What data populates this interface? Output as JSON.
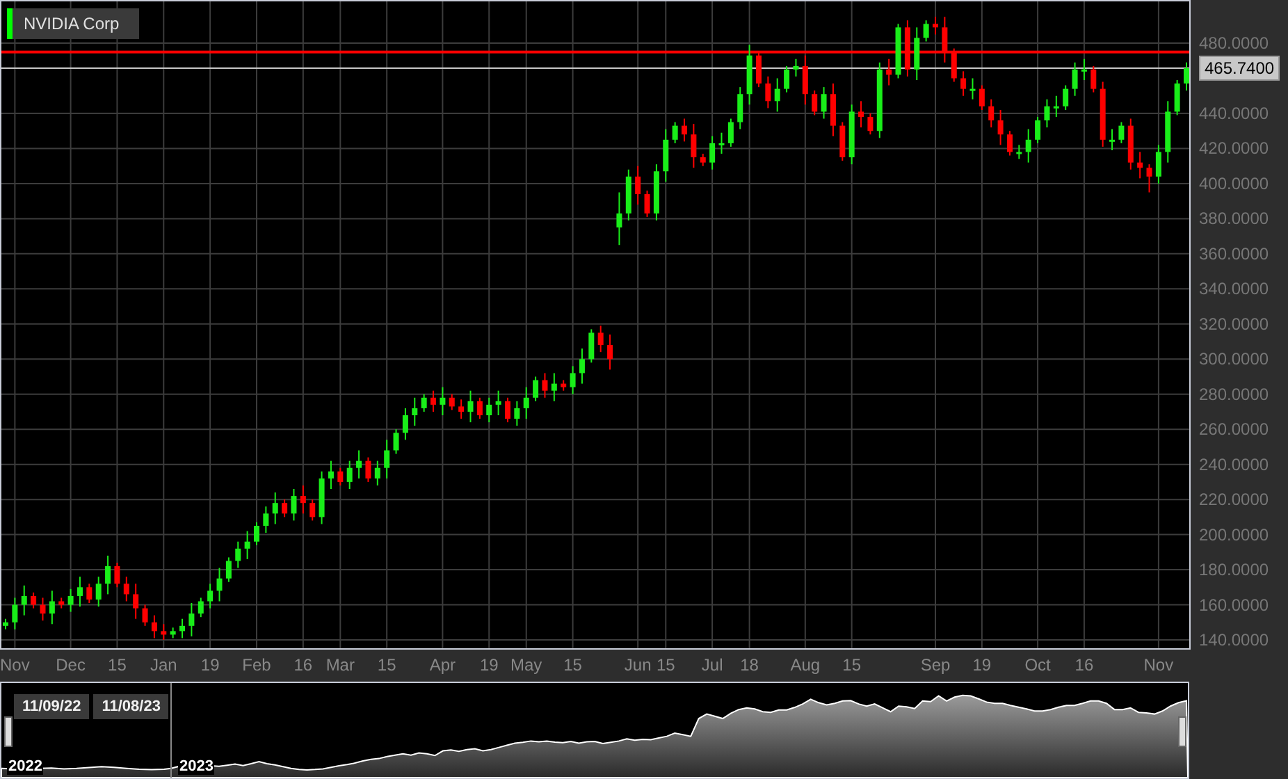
{
  "legend": {
    "label": "NVIDIA Corp",
    "color": "#00ff00"
  },
  "chart_data": {
    "type": "candlestick",
    "categories": [
      null,
      "Nov",
      null,
      null,
      null,
      null,
      null,
      "Dec",
      null,
      null,
      null,
      null,
      "15",
      null,
      null,
      null,
      null,
      "Jan",
      null,
      null,
      null,
      null,
      "19",
      null,
      null,
      null,
      null,
      "Feb",
      null,
      null,
      null,
      null,
      "16",
      null,
      null,
      null,
      "Mar",
      null,
      null,
      null,
      null,
      "15",
      null,
      null,
      null,
      null,
      null,
      "Apr",
      null,
      null,
      null,
      null,
      "19",
      null,
      null,
      null,
      "May",
      null,
      null,
      null,
      null,
      "15",
      null,
      null,
      null,
      null,
      null,
      null,
      "Jun",
      null,
      null,
      "15",
      null,
      null,
      null,
      null,
      "Jul",
      null,
      null,
      null,
      "18",
      null,
      null,
      null,
      null,
      null,
      "Aug",
      null,
      null,
      null,
      null,
      "15",
      null,
      null,
      null,
      null,
      null,
      null,
      null,
      null,
      "Sep",
      null,
      null,
      null,
      null,
      "19",
      null,
      null,
      null,
      null,
      null,
      "Oct",
      null,
      null,
      null,
      null,
      "16",
      null,
      null,
      null,
      null,
      null,
      null,
      null,
      "Nov",
      null,
      null,
      null
    ],
    "ohlc": [
      [
        148,
        152,
        146,
        150
      ],
      [
        150,
        164,
        146,
        160
      ],
      [
        160,
        171,
        154,
        165
      ],
      [
        165,
        167,
        158,
        160
      ],
      [
        160,
        164,
        151,
        155
      ],
      [
        155,
        168,
        149,
        162
      ],
      [
        162,
        164,
        158,
        160
      ],
      [
        160,
        169,
        156,
        165
      ],
      [
        165,
        176,
        159,
        170
      ],
      [
        170,
        172,
        161,
        163
      ],
      [
        163,
        176,
        159,
        172
      ],
      [
        172,
        188,
        166,
        182
      ],
      [
        182,
        184,
        170,
        172
      ],
      [
        172,
        176,
        162,
        166
      ],
      [
        166,
        172,
        152,
        158
      ],
      [
        158,
        160,
        148,
        150
      ],
      [
        150,
        154,
        141,
        145
      ],
      [
        145,
        149,
        140,
        143
      ],
      [
        143,
        147,
        141,
        145
      ],
      [
        145,
        152,
        141,
        148
      ],
      [
        148,
        161,
        142,
        155
      ],
      [
        155,
        164,
        153,
        162
      ],
      [
        162,
        172,
        158,
        168
      ],
      [
        168,
        181,
        162,
        175
      ],
      [
        175,
        187,
        173,
        185
      ],
      [
        185,
        196,
        181,
        192
      ],
      [
        192,
        202,
        186,
        196
      ],
      [
        196,
        207,
        194,
        205
      ],
      [
        205,
        216,
        201,
        212
      ],
      [
        212,
        224,
        206,
        218
      ],
      [
        218,
        220,
        210,
        212
      ],
      [
        212,
        226,
        208,
        222
      ],
      [
        222,
        228,
        212,
        218
      ],
      [
        218,
        220,
        208,
        210
      ],
      [
        210,
        236,
        206,
        232
      ],
      [
        232,
        242,
        226,
        236
      ],
      [
        236,
        238,
        228,
        230
      ],
      [
        230,
        242,
        226,
        238
      ],
      [
        238,
        248,
        232,
        242
      ],
      [
        242,
        244,
        230,
        232
      ],
      [
        232,
        242,
        228,
        238
      ],
      [
        238,
        254,
        232,
        248
      ],
      [
        248,
        260,
        246,
        258
      ],
      [
        258,
        272,
        254,
        268
      ],
      [
        268,
        278,
        262,
        272
      ],
      [
        272,
        280,
        270,
        278
      ],
      [
        278,
        282,
        270,
        274
      ],
      [
        274,
        284,
        268,
        278
      ],
      [
        278,
        280,
        271,
        273
      ],
      [
        273,
        277,
        266,
        270
      ],
      [
        270,
        282,
        264,
        276
      ],
      [
        276,
        278,
        266,
        268
      ],
      [
        268,
        278,
        264,
        274
      ],
      [
        274,
        282,
        268,
        276
      ],
      [
        276,
        278,
        264,
        266
      ],
      [
        266,
        276,
        262,
        272
      ],
      [
        272,
        284,
        266,
        278
      ],
      [
        278,
        290,
        276,
        288
      ],
      [
        288,
        292,
        278,
        282
      ],
      [
        282,
        292,
        276,
        286
      ],
      [
        286,
        288,
        282,
        284
      ],
      [
        284,
        296,
        280,
        292
      ],
      [
        292,
        306,
        286,
        300
      ],
      [
        300,
        317,
        298,
        315
      ],
      [
        315,
        319,
        304,
        308
      ],
      [
        308,
        314,
        294,
        300
      ],
      [
        375,
        395,
        365,
        383
      ],
      [
        383,
        408,
        379,
        404
      ],
      [
        404,
        410,
        388,
        394
      ],
      [
        394,
        396,
        381,
        383
      ],
      [
        383,
        411,
        379,
        407
      ],
      [
        407,
        431,
        401,
        425
      ],
      [
        425,
        435,
        423,
        433
      ],
      [
        433,
        437,
        424,
        428
      ],
      [
        428,
        434,
        409,
        415
      ],
      [
        415,
        417,
        410,
        412
      ],
      [
        412,
        427,
        408,
        423
      ],
      [
        423,
        429,
        417,
        423
      ],
      [
        423,
        437,
        421,
        435
      ],
      [
        435,
        455,
        431,
        451
      ],
      [
        451,
        479,
        445,
        473
      ],
      [
        473,
        475,
        455,
        457
      ],
      [
        457,
        461,
        443,
        447
      ],
      [
        447,
        460,
        441,
        454
      ],
      [
        454,
        467,
        452,
        465
      ],
      [
        465,
        471,
        461,
        467
      ],
      [
        467,
        473,
        445,
        451
      ],
      [
        451,
        453,
        439,
        441
      ],
      [
        441,
        455,
        437,
        451
      ],
      [
        451,
        457,
        427,
        433
      ],
      [
        433,
        435,
        413,
        415
      ],
      [
        415,
        445,
        411,
        441
      ],
      [
        441,
        447,
        432,
        438
      ],
      [
        438,
        440,
        428,
        430
      ],
      [
        430,
        469,
        426,
        465
      ],
      [
        465,
        471,
        456,
        462
      ],
      [
        462,
        491,
        460,
        489
      ],
      [
        489,
        493,
        461,
        465
      ],
      [
        465,
        489,
        459,
        483
      ],
      [
        483,
        493,
        481,
        491
      ],
      [
        491,
        495,
        485,
        489
      ],
      [
        489,
        495,
        469,
        475
      ],
      [
        475,
        477,
        458,
        460
      ],
      [
        460,
        464,
        450,
        454
      ],
      [
        454,
        460,
        448,
        454
      ],
      [
        454,
        456,
        442,
        444
      ],
      [
        444,
        448,
        432,
        436
      ],
      [
        436,
        442,
        422,
        428
      ],
      [
        428,
        430,
        416,
        418
      ],
      [
        418,
        422,
        414,
        418
      ],
      [
        418,
        431,
        412,
        425
      ],
      [
        425,
        438,
        423,
        436
      ],
      [
        436,
        448,
        432,
        444
      ],
      [
        444,
        450,
        438,
        444
      ],
      [
        444,
        456,
        442,
        454
      ],
      [
        454,
        469,
        450,
        465
      ],
      [
        465,
        471,
        459,
        465
      ],
      [
        465,
        467,
        452,
        454
      ],
      [
        454,
        458,
        421,
        425
      ],
      [
        425,
        431,
        419,
        425
      ],
      [
        425,
        435,
        423,
        433
      ],
      [
        433,
        437,
        408,
        412
      ],
      [
        412,
        418,
        403,
        409
      ],
      [
        409,
        411,
        395,
        404
      ],
      [
        404,
        422,
        400,
        418
      ],
      [
        418,
        447,
        412,
        441
      ],
      [
        441,
        459,
        439,
        457
      ],
      [
        457,
        469,
        453,
        465.74
      ]
    ],
    "ylim": [
      140,
      504.6
    ],
    "yticks": [
      {
        "value": 480,
        "label": "480.0000"
      },
      {
        "value": 440,
        "label": "440.0000"
      },
      {
        "value": 420,
        "label": "420.0000"
      },
      {
        "value": 400,
        "label": "400.0000"
      },
      {
        "value": 380,
        "label": "380.0000"
      },
      {
        "value": 360,
        "label": "360.0000"
      },
      {
        "value": 340,
        "label": "340.0000"
      },
      {
        "value": 320,
        "label": "320.0000"
      },
      {
        "value": 300,
        "label": "300.0000"
      },
      {
        "value": 280,
        "label": "280.0000"
      },
      {
        "value": 260,
        "label": "260.0000"
      },
      {
        "value": 240,
        "label": "240.0000"
      },
      {
        "value": 220,
        "label": "220.0000"
      },
      {
        "value": 200,
        "label": "200.0000"
      },
      {
        "value": 180,
        "label": "180.0000"
      },
      {
        "value": 160,
        "label": "160.0000"
      },
      {
        "value": 140,
        "label": "140.0000"
      }
    ],
    "grid": true,
    "ref_lines": [
      {
        "axis": "y",
        "value": 475,
        "color": "#ff0000"
      },
      {
        "axis": "y",
        "value": 465.74,
        "color": "#c8c8c8",
        "label": "465.7400"
      }
    ]
  },
  "navigator": {
    "start_date": "11/09/22",
    "end_date": "11/08/23",
    "years": [
      "2022",
      "2023"
    ]
  }
}
